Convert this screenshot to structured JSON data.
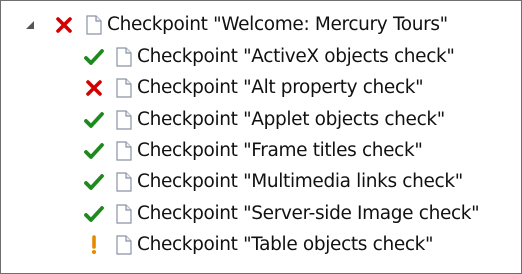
{
  "tree": {
    "root": {
      "label": "Checkpoint \"Welcome: Mercury Tours\"",
      "status": "failed",
      "expanded": true
    },
    "children": [
      {
        "label": "Checkpoint \"ActiveX objects check\"",
        "status": "passed"
      },
      {
        "label": "Checkpoint \"Alt property check\"",
        "status": "failed"
      },
      {
        "label": "Checkpoint \"Applet objects check\"",
        "status": "passed"
      },
      {
        "label": "Checkpoint \"Frame titles check\"",
        "status": "passed"
      },
      {
        "label": "Checkpoint \"Multimedia links check\"",
        "status": "passed"
      },
      {
        "label": "Checkpoint \"Server-side Image check\"",
        "status": "passed"
      },
      {
        "label": "Checkpoint \"Table objects check\"",
        "status": "warning"
      }
    ]
  },
  "icons": {
    "expander": "collapse-triangle-icon",
    "passed": "checkmark-icon",
    "failed": "cross-icon",
    "warning": "exclamation-icon",
    "node": "document-icon"
  },
  "colors": {
    "passed": "#1e8a1e",
    "failed": "#d40000",
    "warning": "#e58a00",
    "document": "#8a93a3",
    "expander": "#555555"
  }
}
